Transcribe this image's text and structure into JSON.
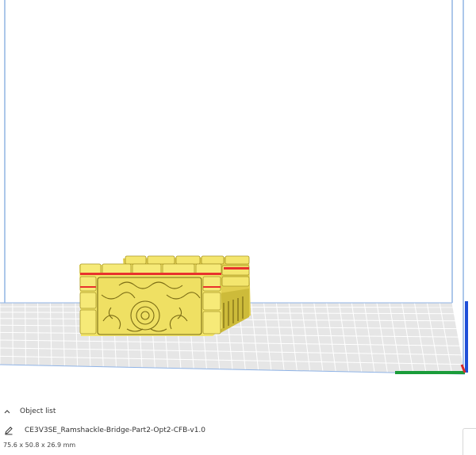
{
  "viewport": {
    "bed_color": "#e6e6e6",
    "grid_color": "#ffffff",
    "volume_edge_color": "#5a8fd6",
    "model_color": "#f2e56a",
    "overhang_color": "#e8322d",
    "axis_z_color": "#1e4fd8",
    "axis_x_color": "#1a9c3a",
    "axis_y_color": "#d72a2a"
  },
  "object_list": {
    "header_label": "Object list",
    "expand_icon": "chevron-up-icon",
    "edit_icon": "pencil-icon",
    "file_name": "CE3V3SE_Ramshackle-Bridge-Part2-Opt2-CFB-v1.0",
    "dimensions": "75.6 x 50.8 x 26.9 mm"
  }
}
